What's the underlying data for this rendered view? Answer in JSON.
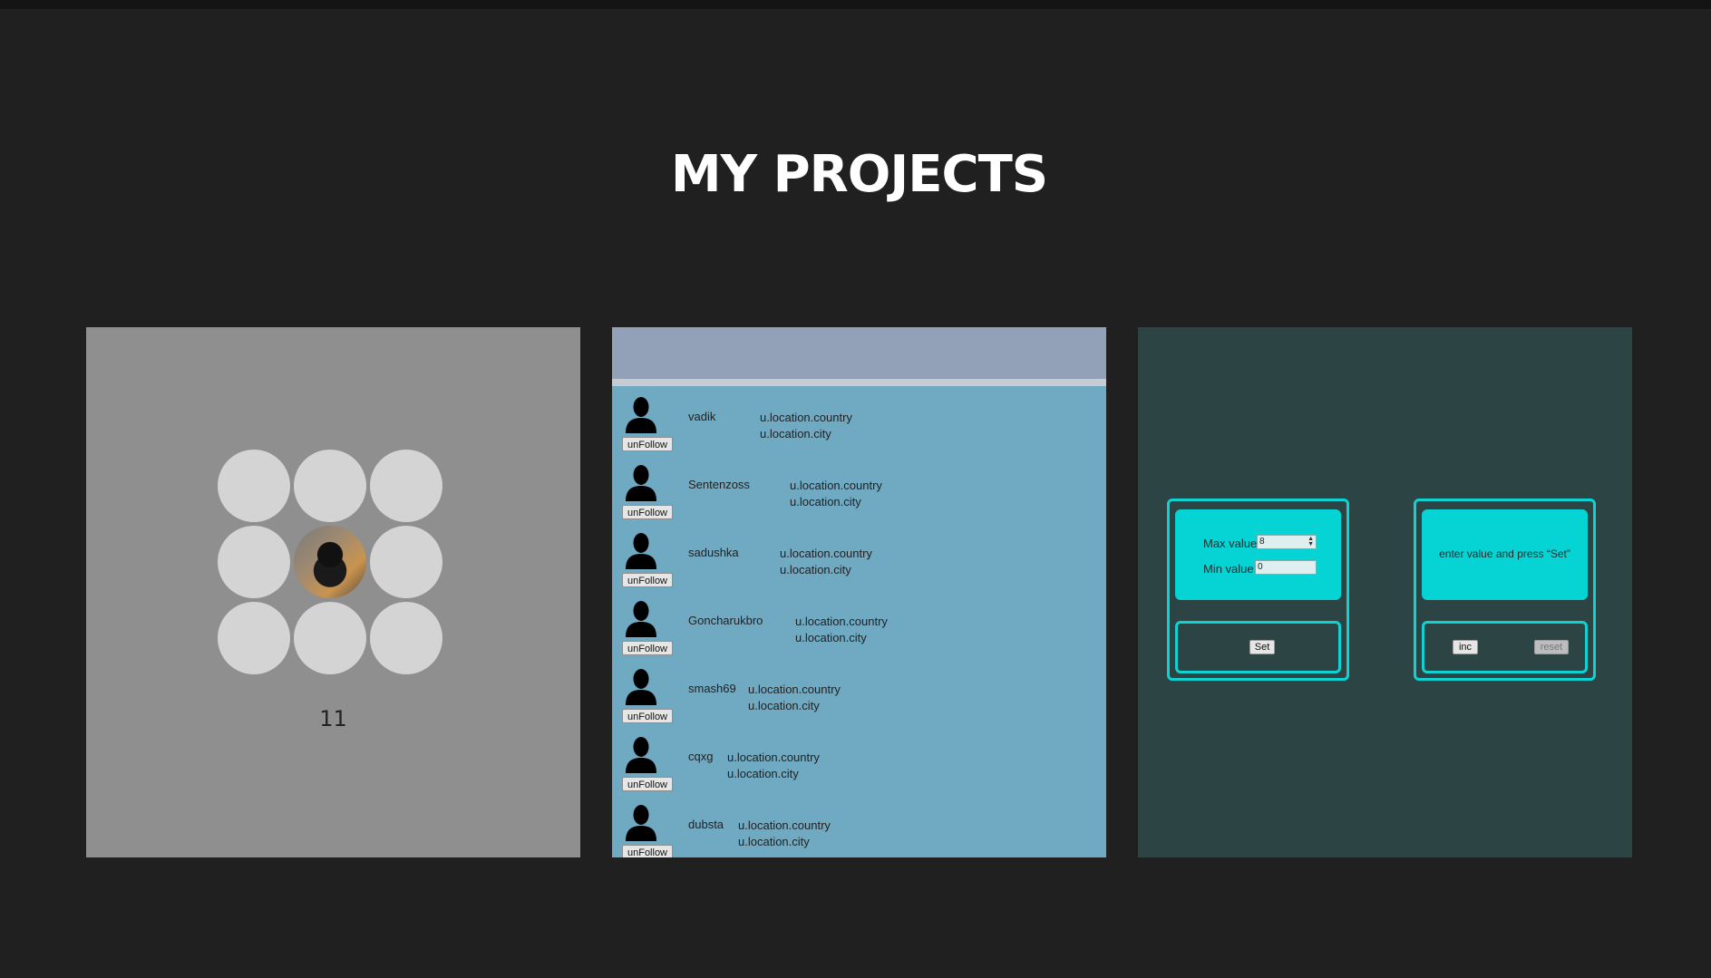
{
  "page": {
    "title": "MY PROJECTS"
  },
  "colors": {
    "background": "#202020",
    "accent": "#06d3d3"
  },
  "projects": [
    {
      "id": "game",
      "score": "11",
      "grid": {
        "rows": 3,
        "cols": 3,
        "active_cell_row": 2,
        "active_cell_col": 2
      }
    },
    {
      "id": "users",
      "users": [
        {
          "name": "vadik",
          "country": "u.location.country",
          "city": "u.location.city",
          "button": "unFollow"
        },
        {
          "name": "Sentenzoss",
          "country": "u.location.country",
          "city": "u.location.city",
          "button": "unFollow"
        },
        {
          "name": "sadushka",
          "country": "u.location.country",
          "city": "u.location.city",
          "button": "unFollow"
        },
        {
          "name": "Goncharukbro",
          "country": "u.location.country",
          "city": "u.location.city",
          "button": "unFollow"
        },
        {
          "name": "smash69",
          "country": "u.location.country",
          "city": "u.location.city",
          "button": "unFollow"
        },
        {
          "name": "cqxg",
          "country": "u.location.country",
          "city": "u.location.city",
          "button": "unFollow"
        },
        {
          "name": "dubsta",
          "country": "u.location.country",
          "city": "u.location.city",
          "button": "unFollow"
        }
      ]
    },
    {
      "id": "counter",
      "settings": {
        "max_label": "Max value:",
        "max_value": "8",
        "min_label": "Min value:",
        "min_value": "0",
        "set_button": "Set"
      },
      "counter": {
        "display": "enter value and press “Set”",
        "inc_button": "inc",
        "reset_button": "reset"
      }
    }
  ]
}
